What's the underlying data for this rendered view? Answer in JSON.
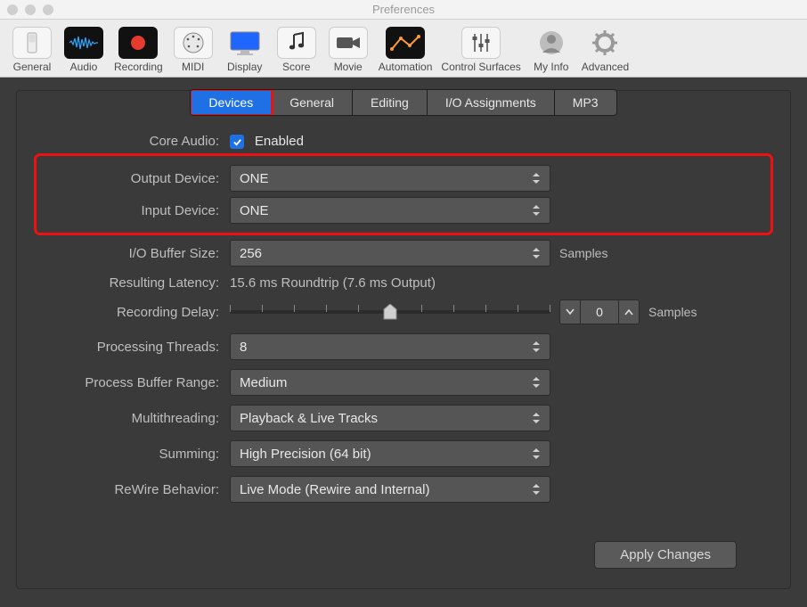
{
  "window": {
    "title": "Preferences"
  },
  "toolbar": {
    "items": [
      {
        "id": "general",
        "label": "General"
      },
      {
        "id": "audio",
        "label": "Audio"
      },
      {
        "id": "recording",
        "label": "Recording"
      },
      {
        "id": "midi",
        "label": "MIDI"
      },
      {
        "id": "display",
        "label": "Display"
      },
      {
        "id": "score",
        "label": "Score"
      },
      {
        "id": "movie",
        "label": "Movie"
      },
      {
        "id": "automation",
        "label": "Automation"
      },
      {
        "id": "control-surfaces",
        "label": "Control Surfaces"
      },
      {
        "id": "my-info",
        "label": "My Info"
      },
      {
        "id": "advanced",
        "label": "Advanced"
      }
    ],
    "selected": "audio"
  },
  "subtabs": {
    "items": [
      {
        "id": "devices",
        "label": "Devices"
      },
      {
        "id": "general",
        "label": "General"
      },
      {
        "id": "editing",
        "label": "Editing"
      },
      {
        "id": "io-assignments",
        "label": "I/O Assignments"
      },
      {
        "id": "mp3",
        "label": "MP3"
      }
    ],
    "active": "devices",
    "highlighted": "devices"
  },
  "form": {
    "core_audio": {
      "label": "Core Audio:",
      "checkbox_label": "Enabled",
      "checked": true
    },
    "output_device": {
      "label": "Output Device:",
      "value": "ONE"
    },
    "input_device": {
      "label": "Input Device:",
      "value": "ONE"
    },
    "io_buffer": {
      "label": "I/O Buffer Size:",
      "value": "256",
      "suffix": "Samples"
    },
    "latency": {
      "label": "Resulting Latency:",
      "value": "15.6 ms Roundtrip (7.6 ms Output)"
    },
    "recording_delay": {
      "label": "Recording Delay:",
      "value": "0",
      "suffix": "Samples",
      "slider_pos_pct": 50,
      "ticks": 11
    },
    "processing_threads": {
      "label": "Processing Threads:",
      "value": "8"
    },
    "process_buffer_range": {
      "label": "Process Buffer Range:",
      "value": "Medium"
    },
    "multithreading": {
      "label": "Multithreading:",
      "value": "Playback & Live Tracks"
    },
    "summing": {
      "label": "Summing:",
      "value": "High Precision (64 bit)"
    },
    "rewire": {
      "label": "ReWire Behavior:",
      "value": "Live Mode (Rewire and Internal)"
    }
  },
  "buttons": {
    "apply": "Apply Changes"
  },
  "colors": {
    "accent": "#1f6fe5",
    "highlight": "#ee1111",
    "panel": "#3b3b3b",
    "control": "#555555"
  }
}
